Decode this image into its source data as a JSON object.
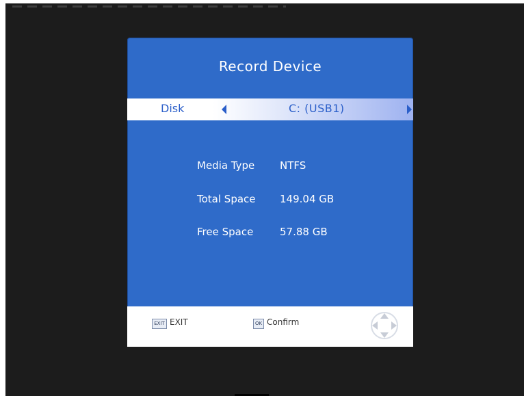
{
  "dialog": {
    "title": "Record Device",
    "selector": {
      "label": "Disk",
      "value": "C: (USB1)"
    },
    "info": [
      {
        "label": "Media Type",
        "value": "NTFS"
      },
      {
        "label": "Total Space",
        "value": "149.04 GB"
      },
      {
        "label": "Free Space",
        "value": "57.88 GB"
      }
    ],
    "footer": {
      "exit_key": "EXIT",
      "exit_label": "EXIT",
      "ok_key": "OK",
      "ok_label": "Confirm",
      "nav_icon": "navigation-pad-icon"
    }
  },
  "colors": {
    "dialog_bg": "#2f6bc9",
    "screen_bg": "#1c1c1c",
    "highlight_text": "#2a5ec9"
  }
}
